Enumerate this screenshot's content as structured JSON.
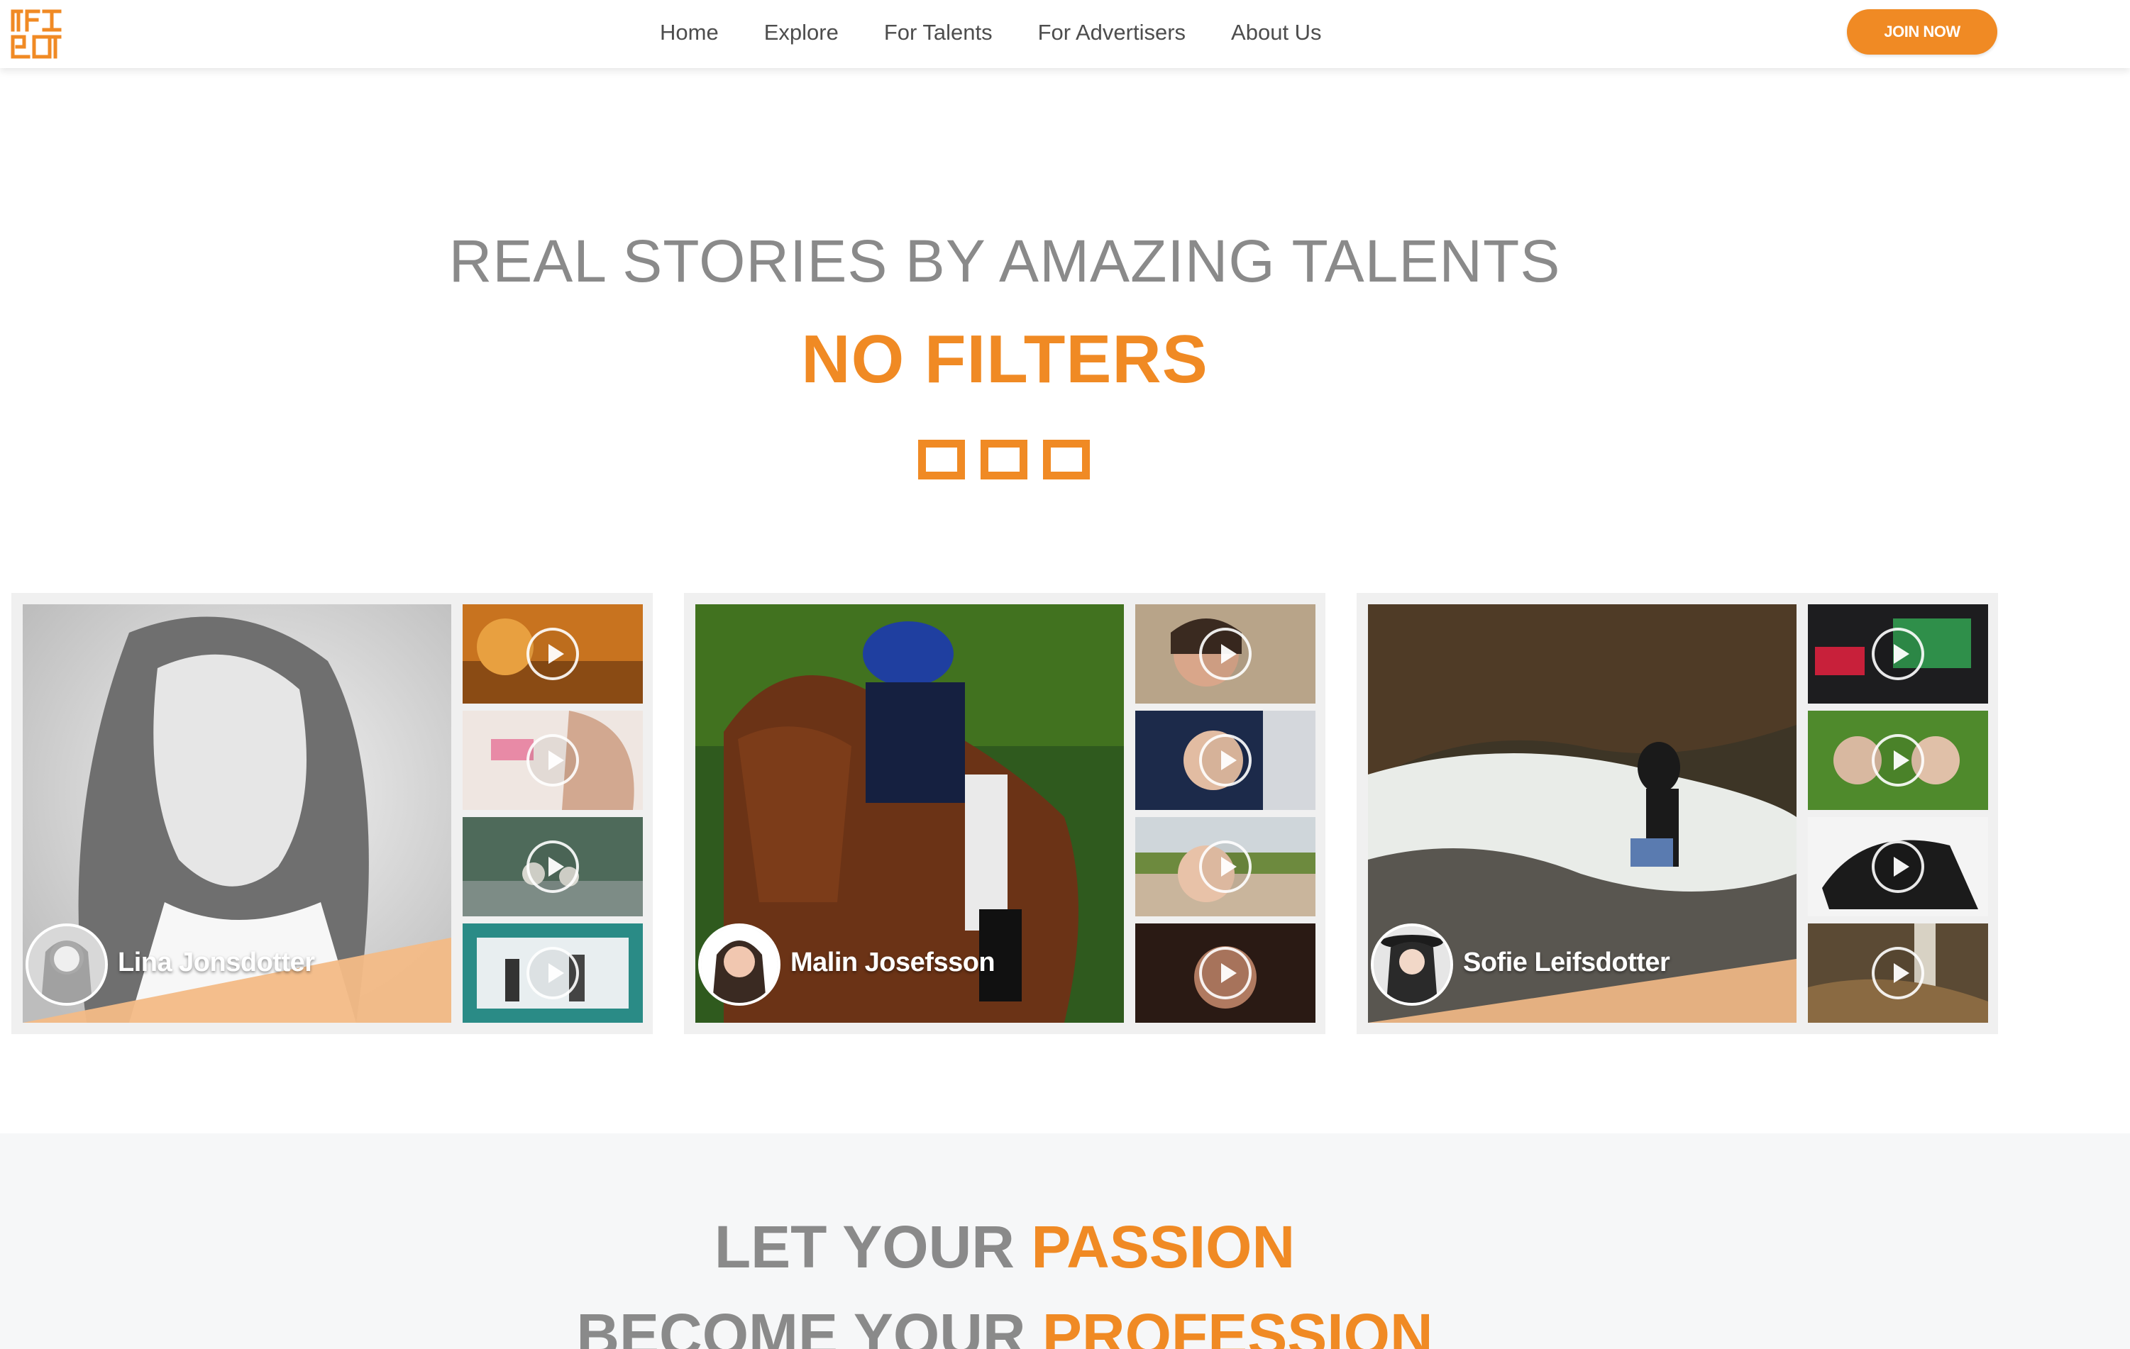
{
  "nav": {
    "items": [
      "Home",
      "Explore",
      "For Talents",
      "For Advertisers",
      "About Us"
    ],
    "join_label": "JOIN NOW"
  },
  "hero": {
    "line1": "REAL STORIES BY AMAZING TALENTS",
    "line2": "NO FILTERS"
  },
  "talents": [
    {
      "name": "Lina Jonsdotter",
      "thumb_count": 4
    },
    {
      "name": "Malin Josefsson",
      "thumb_count": 4
    },
    {
      "name": "Sofie Leifsdotter",
      "thumb_count": 4
    }
  ],
  "passion": {
    "line1_prefix": "LET YOUR ",
    "line1_accent": "PASSION",
    "line2_prefix": "BECOME YOUR ",
    "line2_accent": "PROFESSION"
  },
  "colors": {
    "accent": "#f08a24",
    "heading_gray": "#8a8a8a",
    "nav_text": "#4d4d4d",
    "card_bg": "#f0f0f0",
    "section_bg": "#f6f7f8"
  },
  "icons": [
    "logo-icon",
    "play-icon"
  ]
}
